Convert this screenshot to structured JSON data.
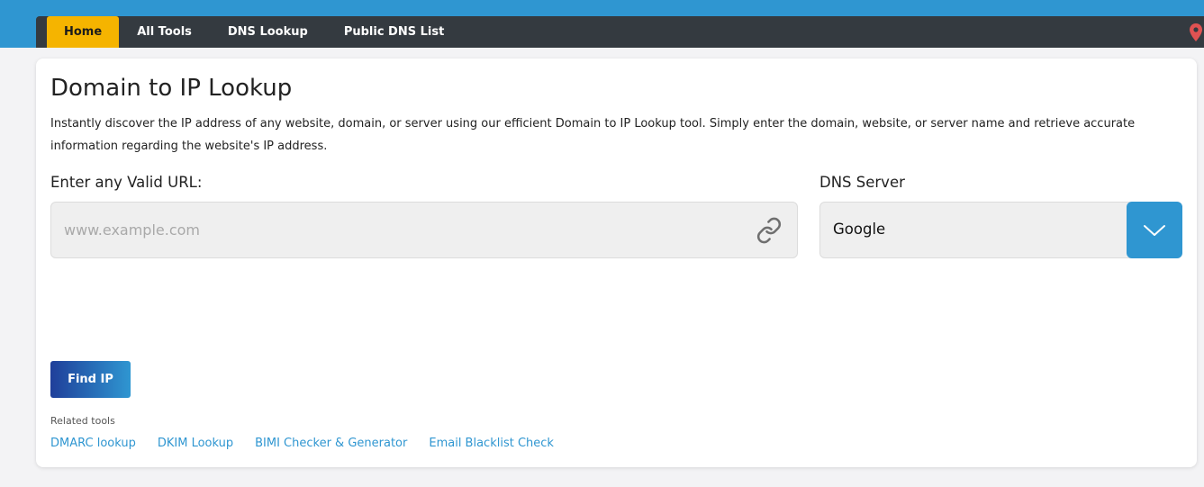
{
  "nav": {
    "items": [
      {
        "label": "Home",
        "active": true
      },
      {
        "label": "All Tools"
      },
      {
        "label": "DNS Lookup"
      },
      {
        "label": "Public DNS List"
      }
    ],
    "right_icon": "map-pin-icon"
  },
  "colors": {
    "brand_blue": "#2f96d1",
    "nav_dark": "#343a40",
    "active_tab": "#f5b400",
    "button_gradient_start": "#1f3f9a",
    "button_gradient_end": "#2f96d1",
    "pin_red": "#e05252"
  },
  "main": {
    "title": "Domain to IP Lookup",
    "description": "Instantly discover the IP address of any website, domain, or server using our efficient Domain to IP Lookup tool. Simply enter the domain, website, or server name and retrieve accurate information regarding the website's IP address.",
    "url_field": {
      "label": "Enter any Valid URL:",
      "value": "",
      "placeholder": "www.example.com",
      "icon": "link-icon"
    },
    "dns_field": {
      "label": "DNS Server",
      "selected": "Google",
      "icon": "chevron-down-icon"
    },
    "find_button": "Find IP",
    "related": {
      "label": "Related tools",
      "links": [
        "DMARC lookup",
        "DKIM Lookup",
        "BIMI Checker & Generator",
        "Email Blacklist Check"
      ]
    }
  }
}
